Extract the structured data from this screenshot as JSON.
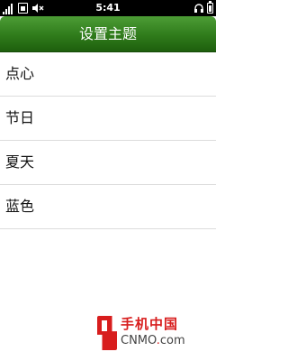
{
  "status_bar": {
    "time": "5:41",
    "left_icons": [
      "signal-icon",
      "sim-card-icon",
      "speaker-muted-icon"
    ],
    "right_icons": [
      "headset-icon",
      "battery-icon"
    ]
  },
  "header": {
    "title": "设置主题"
  },
  "theme_list": {
    "items": [
      {
        "label": "点心"
      },
      {
        "label": "节日"
      },
      {
        "label": "夏天"
      },
      {
        "label": "蓝色"
      }
    ]
  },
  "watermark": {
    "line1": "手机中国",
    "line2_prefix": "CNMO",
    "line2_dot": ".",
    "line2_suffix": "com"
  },
  "colors": {
    "header_green": "#2f7b1b",
    "watermark_red": "#d81d1d"
  }
}
